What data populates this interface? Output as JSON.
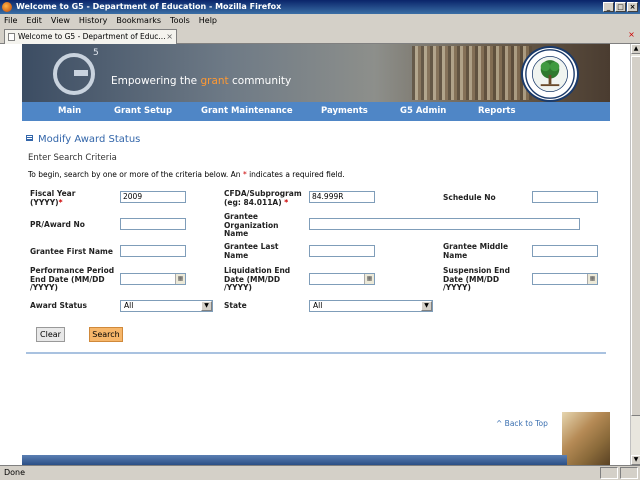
{
  "window": {
    "title": "Welcome to G5 - Department of Education - Mozilla Firefox"
  },
  "menu": [
    "File",
    "Edit",
    "View",
    "History",
    "Bookmarks",
    "Tools",
    "Help"
  ],
  "tab": {
    "label": "Welcome to G5 - Department of Educ...",
    "close": "×"
  },
  "banner": {
    "logo_text": "G",
    "logo_sup": "5",
    "tagline_pre": "Empowering the ",
    "tagline_accent": "grant",
    "tagline_post": " community"
  },
  "nav": [
    "Main",
    "Grant Setup",
    "Grant Maintenance",
    "Payments",
    "G5 Admin",
    "Reports"
  ],
  "section_title": "Modify Award Status",
  "subtitle": "Enter Search Criteria",
  "instructions": {
    "pre": "To begin, search by one or more of the criteria below. An ",
    "star": "*",
    "post": " indicates a required field."
  },
  "form": {
    "fiscal_year_label": "Fiscal Year (YYYY)",
    "fiscal_year_value": "2009",
    "cfda_label": "CFDA/Subprogram (eg: 84.011A)",
    "cfda_value": "84.999R",
    "schedule_label": "Schedule No",
    "pr_award_label": "PR/Award No",
    "grantee_org_label": "Grantee Organization Name",
    "grantee_first_label": "Grantee First Name",
    "grantee_last_label": "Grantee Last Name",
    "grantee_middle_label": "Grantee Middle Name",
    "perf_end_label": "Performance Period End Date (MM/DD /YYYY)",
    "liq_end_label": "Liquidation End Date (MM/DD /YYYY)",
    "susp_end_label": "Suspension End Date (MM/DD /YYYY)",
    "award_status_label": "Award Status",
    "award_status_value": "All",
    "state_label": "State",
    "state_value": "All",
    "required_star": "*"
  },
  "buttons": {
    "clear": "Clear",
    "search": "Search"
  },
  "back_to_top": "^ Back to Top",
  "status": "Done",
  "colors": {
    "nav": "#4f86c6",
    "title": "#3366aa",
    "search_button": "#f6b66a"
  },
  "icons": [
    "firefox-icon",
    "page-icon",
    "calendar-icon",
    "dropdown-arrow-icon",
    "section-icon",
    "ed-seal-icon"
  ]
}
